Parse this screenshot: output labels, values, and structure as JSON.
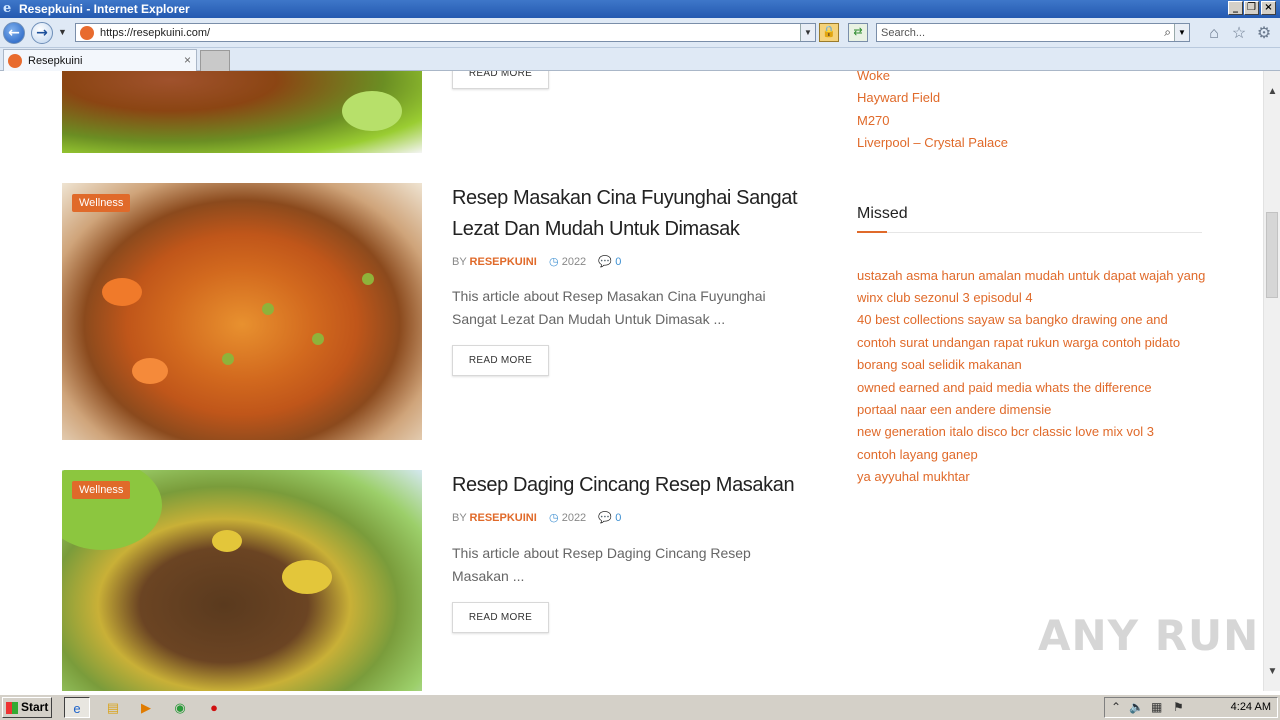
{
  "window": {
    "title": "Resepkuini - Internet Explorer"
  },
  "addressbar": {
    "url": "https://resepkuini.com/",
    "search_placeholder": "Search..."
  },
  "tabs": [
    {
      "label": "Resepkuini",
      "close": "×"
    }
  ],
  "posts": [
    {
      "read_more": "READ MORE"
    },
    {
      "category": "Wellness",
      "title": "Resep Masakan Cina Fuyunghai Sangat Lezat Dan Mudah Untuk Dimasak",
      "by": "BY",
      "author": "RESEPKUINI",
      "year": "2022",
      "comments": "0",
      "excerpt": "This article about Resep Masakan Cina Fuyunghai Sangat Lezat Dan Mudah Untuk Dimasak ...",
      "read_more": "READ MORE"
    },
    {
      "category": "Wellness",
      "title": "Resep Daging Cincang Resep Masakan",
      "by": "BY",
      "author": "RESEPKUINI",
      "year": "2022",
      "comments": "0",
      "excerpt": "This article about Resep Daging Cincang Resep Masakan ...",
      "read_more": "READ MORE"
    }
  ],
  "sidebar": {
    "trending": [
      "Woke",
      "Hayward Field",
      "M270",
      "Liverpool – Crystal Palace"
    ],
    "missed_title": "Missed",
    "missed": [
      "ustazah asma harun amalan mudah untuk dapat wajah yang",
      "winx club sezonul 3 episodul 4",
      "40 best collections sayaw sa bangko drawing one and",
      "contoh surat undangan rapat rukun warga contoh pidato",
      "borang soal selidik makanan",
      "owned earned and paid media whats the difference",
      "portaal naar een andere dimensie",
      "new generation italo disco bcr classic love mix vol 3",
      "contoh layang ganep",
      "ya ayyuhal mukhtar"
    ]
  },
  "watermark": "ANY RUN",
  "taskbar": {
    "start_label": "Start",
    "clock": "4:24 AM"
  },
  "colors": {
    "accent": "#e06a2a",
    "meta_blue": "#3d8fd1",
    "titlebar": "#2f66bd"
  }
}
